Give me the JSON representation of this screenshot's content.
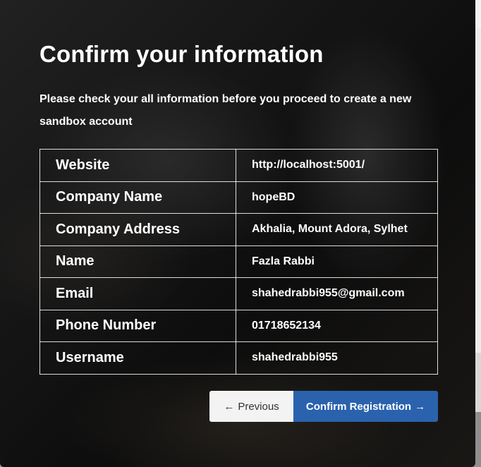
{
  "modal": {
    "title": "Confirm your information",
    "subtitle": "Please check your all information before you proceed to create a new sandbox account"
  },
  "fields": [
    {
      "label": "Website",
      "value": "http://localhost:5001/"
    },
    {
      "label": "Company Name",
      "value": "hopeBD"
    },
    {
      "label": "Company Address",
      "value": "Akhalia, Mount Adora, Sylhet"
    },
    {
      "label": "Name",
      "value": "Fazla Rabbi"
    },
    {
      "label": "Email",
      "value": "shahedrabbi955@gmail.com"
    },
    {
      "label": "Phone Number",
      "value": "01718652134"
    },
    {
      "label": "Username",
      "value": "shahedrabbi955"
    }
  ],
  "buttons": {
    "previous_label": "Previous",
    "previous_icon": "arrow-left-icon",
    "confirm_label": "Confirm Registration",
    "confirm_icon": "arrow-right-icon"
  },
  "colors": {
    "confirm_button": "#2a62ad",
    "previous_button": "#f3f3f3"
  }
}
